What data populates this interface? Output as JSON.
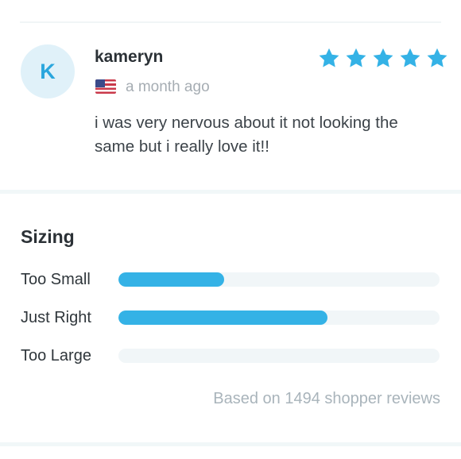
{
  "review": {
    "avatar_initial": "K",
    "author": "kameryn",
    "country_flag": "us-flag-icon",
    "date": "a month ago",
    "rating": 5,
    "rating_max": 5,
    "star_color": "#34b2e6",
    "body": "i was very nervous about it not looking the same but i really love it!!"
  },
  "sizing": {
    "title": "Sizing",
    "rows": [
      {
        "label": "Too Small",
        "fraction": 0.33
      },
      {
        "label": "Just Right",
        "fraction": 0.65
      },
      {
        "label": "Too Large",
        "fraction": 0.0
      }
    ],
    "bar_color": "#34b2e6",
    "summary": "Based on 1494 shopper reviews"
  }
}
